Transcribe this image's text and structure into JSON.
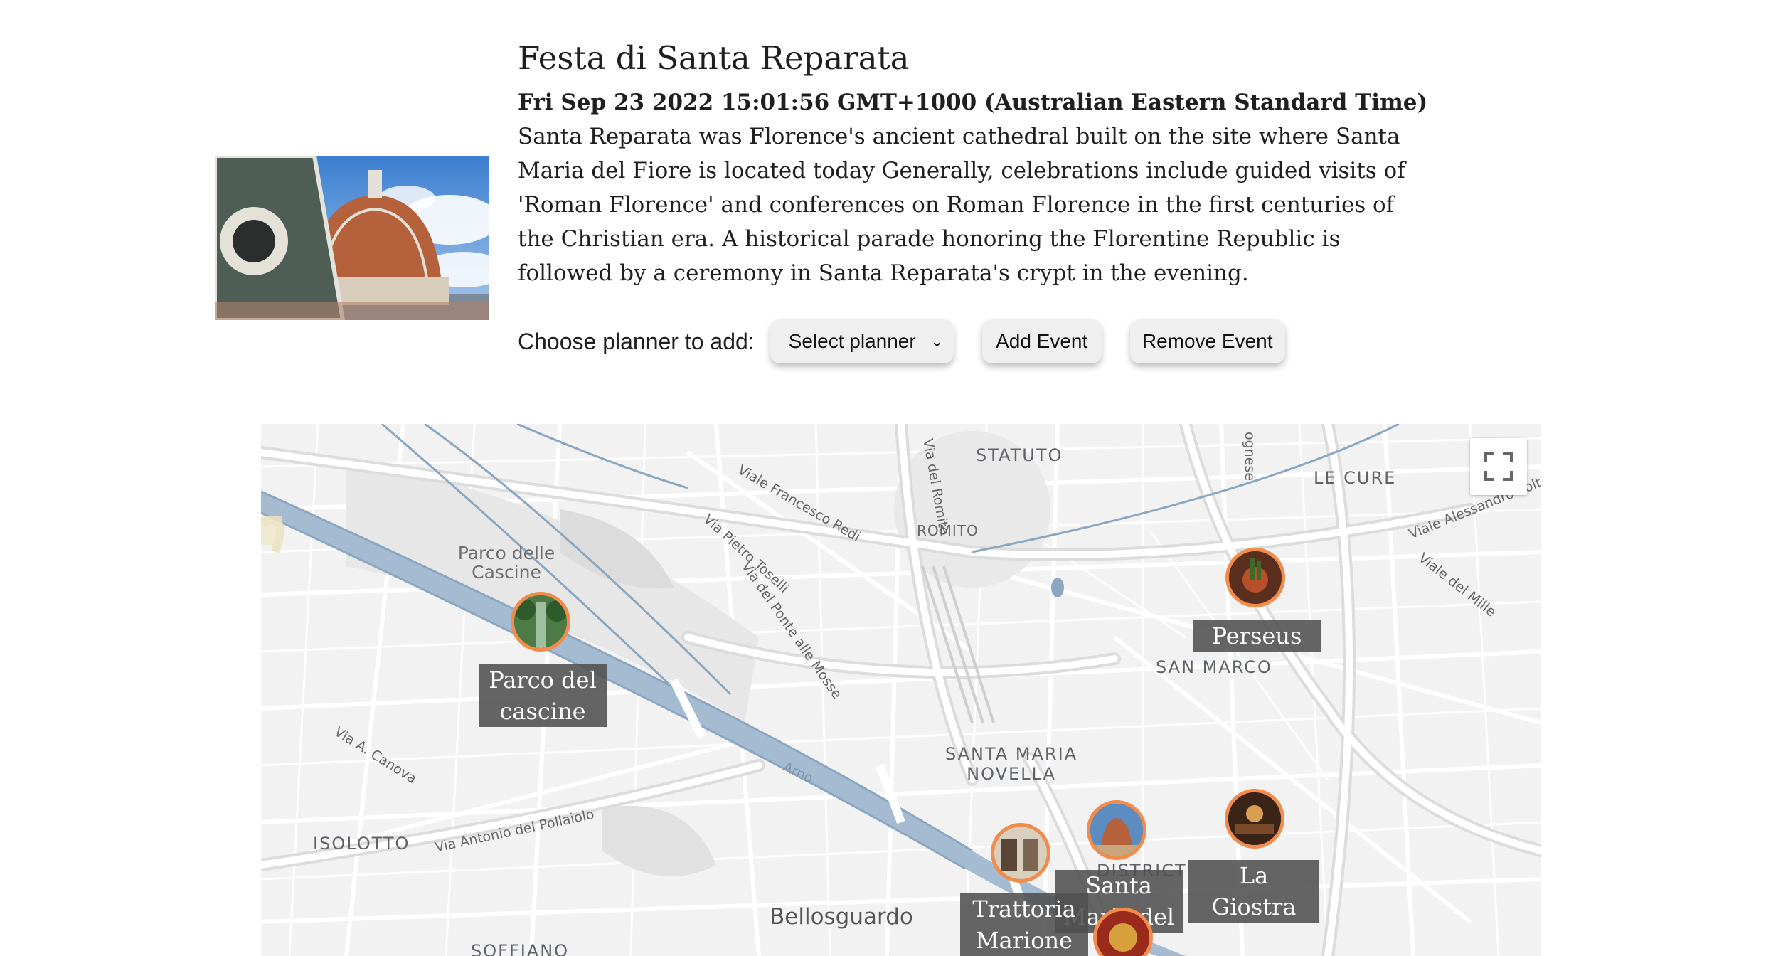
{
  "event": {
    "title": "Festa di Santa Reparata",
    "date": "Fri Sep 23 2022 15:01:56 GMT+1000 (Australian Eastern Standard Time)",
    "description": "Santa Reparata was Florence's ancient cathedral built on the site where Santa Maria del Fiore is located today Generally, celebrations include guided visits of 'Roman Florence' and conferences on Roman Florence in the first centuries of the Christian era. A historical parade honoring the Florentine Republic is followed by a ceremony in Santa Reparata's crypt in the evening."
  },
  "planner": {
    "label": "Choose planner to add:",
    "select_value": "Select planner",
    "add_label": "Add Event",
    "remove_label": "Remove Event"
  },
  "map": {
    "labels": {
      "statuto": "STATUTO",
      "le_cure": "LE CURE",
      "romito": "ROMITO",
      "san_marco": "SAN MARCO",
      "santa_maria_novella": "SANTA MARIA NOVELLA",
      "isolotto": "ISOLOTTO",
      "district": "DISTRICT",
      "soffiano": "SOFFIANO",
      "bellosguardo": "Bellosguardo",
      "parco_delle_cascine": "Parco delle Cascine",
      "viale_francesco_redi": "Viale Francesco Redi",
      "via_del_romito": "Via del Romito",
      "via_pietro_toselli": "Via Pietro Toselli",
      "via_del_ponte_alle_mosse": "Via del Ponte alle Mosse",
      "via_a_canova": "Via A. Canova",
      "via_antonio_del_pollaiolo": "Via Antonio del Pollaiolo",
      "viale_alessandro_volta": "Viale Alessandro Volta",
      "viale_dei_mille": "Viale dei Mille",
      "ognese": "ognese",
      "arno": "Arno"
    },
    "markers": [
      {
        "name": "Parco del cascine"
      },
      {
        "name": "Perseus"
      },
      {
        "name": "La Giostra"
      },
      {
        "name": "Santa Maria del Fiore"
      },
      {
        "name": "Trattoria Marione"
      }
    ]
  }
}
